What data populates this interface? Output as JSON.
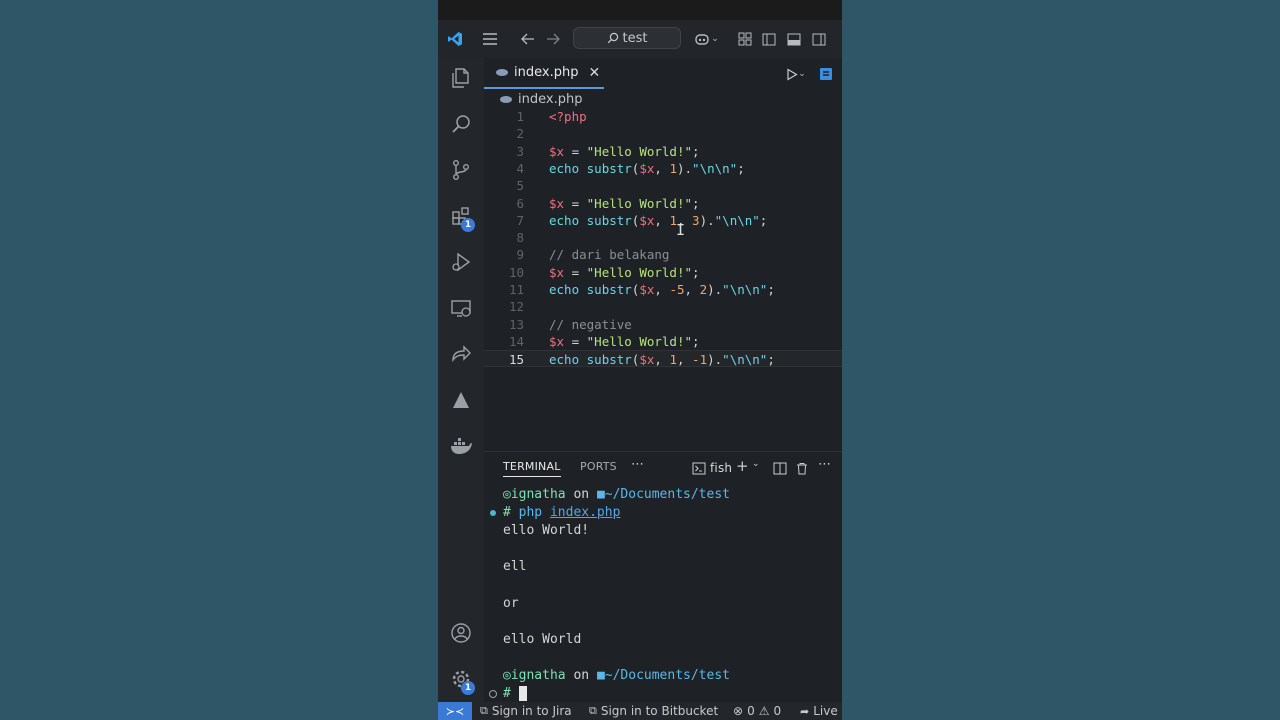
{
  "titlebar": {
    "search_text": "test",
    "icons": [
      "vscode-logo-icon",
      "menu-icon",
      "arrow-left-icon",
      "arrow-right-icon",
      "copilot-icon",
      "chevron-down-icon",
      "layout-customize-icon",
      "toggle-primary-sidebar-icon",
      "toggle-panel-icon",
      "toggle-secondary-sidebar-icon"
    ]
  },
  "activity_bar": {
    "items": [
      {
        "name": "explorer-icon"
      },
      {
        "name": "search-icon"
      },
      {
        "name": "source-control-icon"
      },
      {
        "name": "extensions-icon",
        "badge": "1"
      },
      {
        "name": "run-debug-icon"
      },
      {
        "name": "remote-explorer-icon"
      },
      {
        "name": "live-share-icon"
      },
      {
        "name": "atlassian-icon"
      },
      {
        "name": "docker-icon"
      }
    ],
    "bottom": [
      {
        "name": "accounts-icon"
      },
      {
        "name": "manage-gear-icon",
        "badge": "1"
      }
    ]
  },
  "editor": {
    "tab_label": "index.php",
    "breadcrumb": "index.php",
    "current_line": 15,
    "lines": [
      {
        "n": "1",
        "tokens": [
          {
            "t": "<?php",
            "c": "#f1707f"
          }
        ]
      },
      {
        "n": "2",
        "tokens": []
      },
      {
        "n": "3",
        "tokens": [
          {
            "t": "$x",
            "c": "#f1707f"
          },
          {
            "t": " = ",
            "c": "#d4d4d4"
          },
          {
            "t": "\"Hello World!\"",
            "c": "#b7e27d"
          },
          {
            "t": ";",
            "c": "#d4d4d4"
          }
        ]
      },
      {
        "n": "4",
        "tokens": [
          {
            "t": "echo ",
            "c": "#6ad6e6"
          },
          {
            "t": "substr",
            "c": "#6ad6e6"
          },
          {
            "t": "(",
            "c": "#d4d4d4"
          },
          {
            "t": "$x",
            "c": "#f1707f"
          },
          {
            "t": ", ",
            "c": "#d4d4d4"
          },
          {
            "t": "1",
            "c": "#f0a46a"
          },
          {
            "t": ").",
            "c": "#d4d4d4"
          },
          {
            "t": "\"\\n\\n\"",
            "c": "#6ad6e6"
          },
          {
            "t": ";",
            "c": "#d4d4d4"
          }
        ]
      },
      {
        "n": "5",
        "tokens": []
      },
      {
        "n": "6",
        "tokens": [
          {
            "t": "$x",
            "c": "#f1707f"
          },
          {
            "t": " = ",
            "c": "#d4d4d4"
          },
          {
            "t": "\"Hello World!\"",
            "c": "#b7e27d"
          },
          {
            "t": ";",
            "c": "#d4d4d4"
          }
        ]
      },
      {
        "n": "7",
        "tokens": [
          {
            "t": "echo ",
            "c": "#6ad6e6"
          },
          {
            "t": "substr",
            "c": "#6ad6e6"
          },
          {
            "t": "(",
            "c": "#d4d4d4"
          },
          {
            "t": "$x",
            "c": "#f1707f"
          },
          {
            "t": ", ",
            "c": "#d4d4d4"
          },
          {
            "t": "1",
            "c": "#f0a46a"
          },
          {
            "t": ", ",
            "c": "#d4d4d4"
          },
          {
            "t": "3",
            "c": "#f0a46a"
          },
          {
            "t": ").",
            "c": "#d4d4d4"
          },
          {
            "t": "\"\\n\\n\"",
            "c": "#6ad6e6"
          },
          {
            "t": ";",
            "c": "#d4d4d4"
          }
        ]
      },
      {
        "n": "8",
        "tokens": []
      },
      {
        "n": "9",
        "tokens": [
          {
            "t": "// dari belakang",
            "c": "#8a8f94"
          }
        ]
      },
      {
        "n": "10",
        "tokens": [
          {
            "t": "$x",
            "c": "#f1707f"
          },
          {
            "t": " = ",
            "c": "#d4d4d4"
          },
          {
            "t": "\"Hello World!\"",
            "c": "#b7e27d"
          },
          {
            "t": ";",
            "c": "#d4d4d4"
          }
        ]
      },
      {
        "n": "11",
        "tokens": [
          {
            "t": "echo ",
            "c": "#6ad6e6"
          },
          {
            "t": "substr",
            "c": "#6ad6e6"
          },
          {
            "t": "(",
            "c": "#d4d4d4"
          },
          {
            "t": "$x",
            "c": "#f1707f"
          },
          {
            "t": ", ",
            "c": "#d4d4d4"
          },
          {
            "t": "-5",
            "c": "#f0a46a"
          },
          {
            "t": ", ",
            "c": "#d4d4d4"
          },
          {
            "t": "2",
            "c": "#f0a46a"
          },
          {
            "t": ").",
            "c": "#d4d4d4"
          },
          {
            "t": "\"\\n\\n\"",
            "c": "#6ad6e6"
          },
          {
            "t": ";",
            "c": "#d4d4d4"
          }
        ]
      },
      {
        "n": "12",
        "tokens": []
      },
      {
        "n": "13",
        "tokens": [
          {
            "t": "// negative",
            "c": "#8a8f94"
          }
        ]
      },
      {
        "n": "14",
        "tokens": [
          {
            "t": "$x",
            "c": "#f1707f"
          },
          {
            "t": " = ",
            "c": "#d4d4d4"
          },
          {
            "t": "\"Hello World!\"",
            "c": "#b7e27d"
          },
          {
            "t": ";",
            "c": "#d4d4d4"
          }
        ]
      },
      {
        "n": "15",
        "tokens": [
          {
            "t": "echo ",
            "c": "#6ad6e6"
          },
          {
            "t": "substr",
            "c": "#6ad6e6"
          },
          {
            "t": "(",
            "c": "#d4d4d4"
          },
          {
            "t": "$x",
            "c": "#f1707f"
          },
          {
            "t": ", ",
            "c": "#d4d4d4"
          },
          {
            "t": "1",
            "c": "#f0a46a"
          },
          {
            "t": ", ",
            "c": "#d4d4d4"
          },
          {
            "t": "-1",
            "c": "#f0a46a"
          },
          {
            "t": ").",
            "c": "#d4d4d4"
          },
          {
            "t": "\"\\n\\n\"",
            "c": "#6ad6e6"
          },
          {
            "t": ";",
            "c": "#d4d4d4"
          }
        ]
      }
    ]
  },
  "panel": {
    "tabs": [
      "TERMINAL",
      "PORTS"
    ],
    "active_tab": "TERMINAL",
    "shell_name": "fish",
    "lines": [
      {
        "kind": "prompt",
        "user": "ignatha",
        "on": " on ",
        "path": "~/Documents/test"
      },
      {
        "kind": "cmd",
        "hash": "#",
        "cmd": "php",
        "arg": "index.php"
      },
      {
        "kind": "out",
        "text": "ello World!"
      },
      {
        "kind": "out",
        "text": ""
      },
      {
        "kind": "out",
        "text": "ell"
      },
      {
        "kind": "out",
        "text": ""
      },
      {
        "kind": "out",
        "text": "or"
      },
      {
        "kind": "out",
        "text": ""
      },
      {
        "kind": "out",
        "text": "ello World"
      },
      {
        "kind": "out",
        "text": ""
      },
      {
        "kind": "prompt",
        "user": "ignatha",
        "on": " on ",
        "path": "~/Documents/test"
      },
      {
        "kind": "input",
        "hash": "#"
      }
    ]
  },
  "statusbar": {
    "jira": "Sign in to Jira",
    "bitbucket": "Sign in to Bitbucket",
    "errors": "0",
    "warnings": "0",
    "live": "Live"
  },
  "colors": {
    "background": "#2f5666",
    "editor_bg": "#1e2226",
    "accent": "#3b7ad9",
    "prompt_green": "#7ee0b0",
    "path_blue": "#5ab7e6",
    "link_blue": "#4fa8e8"
  }
}
